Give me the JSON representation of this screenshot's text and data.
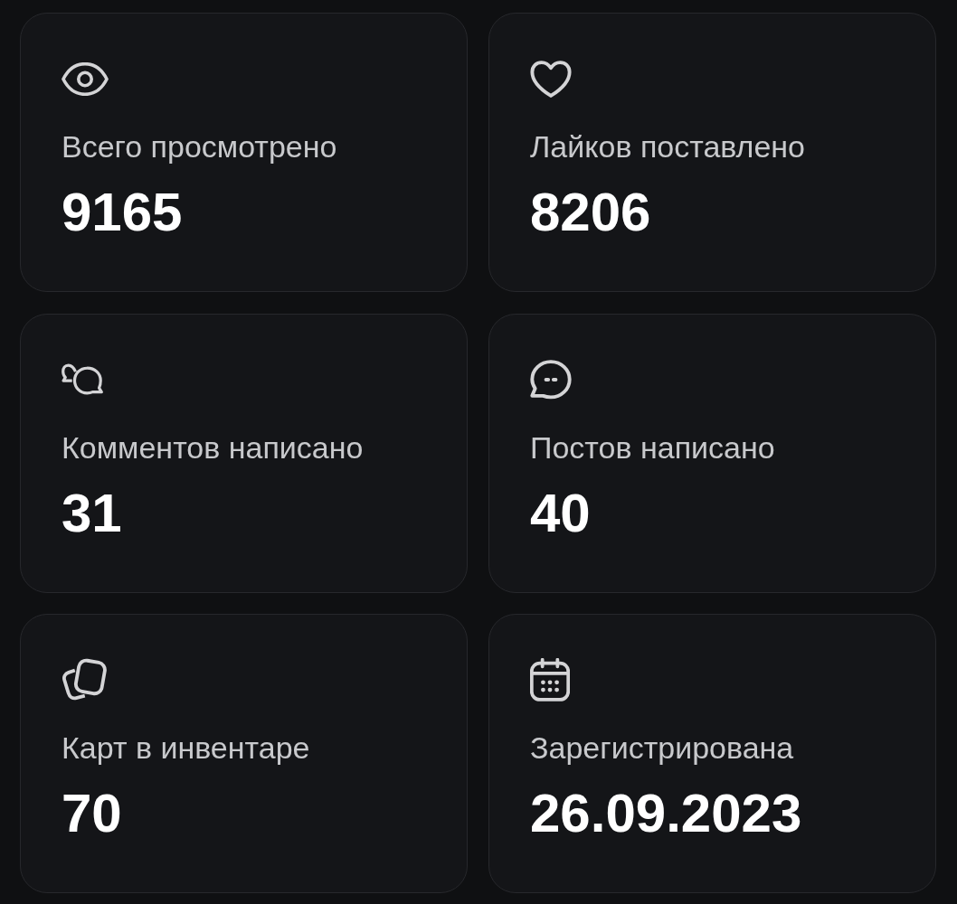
{
  "stats": [
    {
      "kind": "views",
      "label": "Всего просмотрено",
      "value": "9165"
    },
    {
      "kind": "likes",
      "label": "Лайков поставлено",
      "value": "8206"
    },
    {
      "kind": "comments",
      "label": "Комментов написано",
      "value": "31"
    },
    {
      "kind": "posts",
      "label": "Постов написано",
      "value": "40"
    },
    {
      "kind": "cards",
      "label": "Карт в инвентаре",
      "value": "70"
    },
    {
      "kind": "registered",
      "label": "Зарегистрирована",
      "value": "26.09.2023"
    }
  ]
}
